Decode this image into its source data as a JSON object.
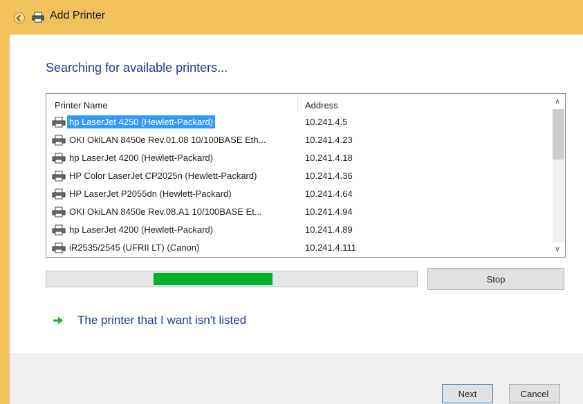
{
  "window": {
    "title": "Add Printer"
  },
  "main": {
    "heading": "Searching for available printers...",
    "columns": {
      "name": "Printer Name",
      "address": "Address"
    },
    "printers": [
      {
        "name": "hp LaserJet 4250 (Hewlett-Packard)",
        "address": "10.241.4.5",
        "selected": true
      },
      {
        "name": "OKI OkiLAN 8450e Rev.01.08 10/100BASE Eth...",
        "address": "10.241.4.23"
      },
      {
        "name": "hp LaserJet 4200 (Hewlett-Packard)",
        "address": "10.241.4.18"
      },
      {
        "name": "HP Color LaserJet CP2025n (Hewlett-Packard)",
        "address": "10.241.4.36"
      },
      {
        "name": "HP LaserJet P2055dn (Hewlett-Packard)",
        "address": "10.241.4.64"
      },
      {
        "name": "OKI OkiLAN 8450e Rev.08.A1 10/100BASE Et...",
        "address": "10.241.4.94"
      },
      {
        "name": "hp LaserJet 4200 (Hewlett-Packard)",
        "address": "10.241.4.89"
      },
      {
        "name": "iR2535/2545 (UFRII LT) (Canon)",
        "address": "10.241.4.111"
      }
    ],
    "scroll": {
      "thumb_start": 0.0,
      "thumb_fraction": 0.38
    },
    "progress": {
      "start": 0.29,
      "end": 0.61
    },
    "stop_label": "Stop",
    "not_listed_label": "The printer that I want isn't listed"
  },
  "footer": {
    "next_label": "Next",
    "cancel_label": "Cancel"
  },
  "colors": {
    "titlebar": "#f1c15b",
    "heading": "#1e3b8c",
    "selection": "#3399ff",
    "progress_fill": "#06b025",
    "link_arrow": "#2aa52a"
  },
  "icons": {
    "back": "back-arrow-icon",
    "title": "printer-icon",
    "row": "printer-icon",
    "link": "green-arrow-icon"
  }
}
